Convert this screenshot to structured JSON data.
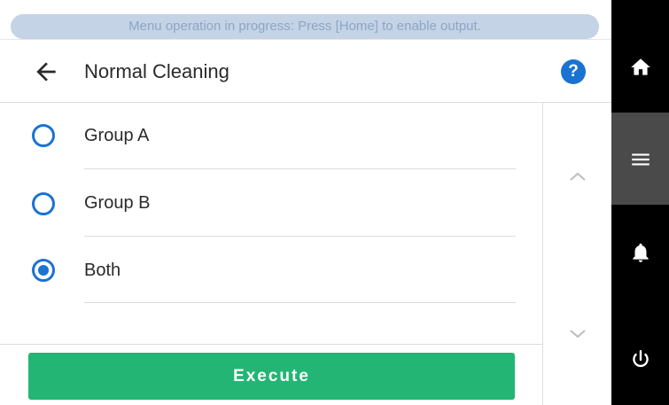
{
  "banner": {
    "text": "Menu operation in progress: Press [Home] to enable output."
  },
  "header": {
    "title": "Normal Cleaning",
    "help_label": "?"
  },
  "options": [
    {
      "label": "Group A",
      "checked": false
    },
    {
      "label": "Group B",
      "checked": false
    },
    {
      "label": "Both",
      "checked": true
    }
  ],
  "execute": {
    "label": "Execute"
  },
  "sidebar": {
    "items": [
      "home-icon",
      "menu-icon",
      "bell-icon",
      "power-icon"
    ],
    "active": "menu-icon"
  },
  "colors": {
    "accent": "#1a73d1",
    "execute": "#23b574",
    "banner_bg": "#c4d3e5",
    "banner_text": "#8ea6c4",
    "sidebar": "#000000",
    "sidebar_active": "#4a4a4a"
  }
}
